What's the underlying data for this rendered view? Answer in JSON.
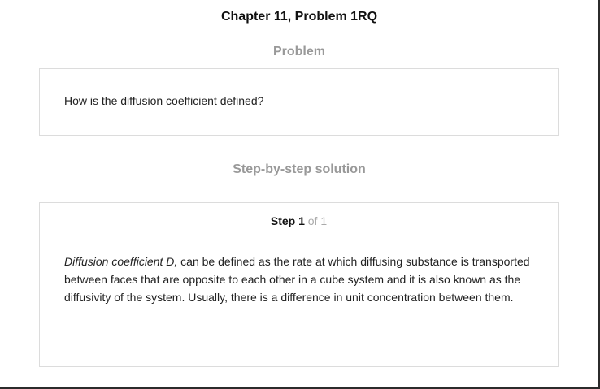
{
  "header": {
    "title": "Chapter 11, Problem 1RQ"
  },
  "problem": {
    "heading": "Problem",
    "question": "How is the diffusion coefficient defined?"
  },
  "solution": {
    "heading": "Step-by-step solution",
    "step": {
      "label": "Step 1",
      "of_text": "of 1"
    },
    "term": "Diffusion coefficient D,",
    "body": " can be defined as the rate at which diffusing substance is transported between faces that are opposite to each other in a cube system and it is also known as the diffusivity of the system. Usually, there is a difference in unit concentration between them."
  }
}
